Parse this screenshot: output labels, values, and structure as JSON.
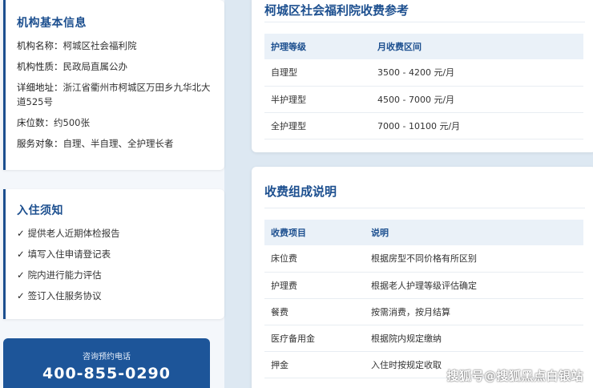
{
  "info_card": {
    "title": "机构基本信息",
    "lines": [
      {
        "label": "机构名称：",
        "value": "柯城区社会福利院"
      },
      {
        "label": "机构性质：",
        "value": "民政局直属公办"
      },
      {
        "label": "详细地址：",
        "value": "浙江省衢州市柯城区万田乡九华北大道525号"
      },
      {
        "label": "床位数：",
        "value": "约500张"
      },
      {
        "label": "服务对象：",
        "value": "自理、半自理、全护理长者"
      }
    ]
  },
  "notes_card": {
    "title": "入住须知",
    "check_mark": "✓",
    "items": [
      "提供老人近期体检报告",
      "填写入住申请登记表",
      "院内进行能力评估",
      "签订入住服务协议"
    ]
  },
  "phone": {
    "label": "咨询预约电话",
    "number": "400-855-0290"
  },
  "fees_card": {
    "title": "柯城区社会福利院收费参考",
    "headers": [
      "护理等级",
      "月收费区间"
    ],
    "rows": [
      [
        "自理型",
        "3500 - 4200 元/月"
      ],
      [
        "半护理型",
        "4500 - 7000 元/月"
      ],
      [
        "全护理型",
        "7000 - 10100 元/月"
      ]
    ]
  },
  "composition_card": {
    "title": "收费组成说明",
    "headers": [
      "收费项目",
      "说明"
    ],
    "rows": [
      [
        "床位费",
        "根据房型不同价格有所区别"
      ],
      [
        "护理费",
        "根据老人护理等级评估确定"
      ],
      [
        "餐费",
        "按需消费，按月结算"
      ],
      [
        "医疗备用金",
        "根据院内规定缴纳"
      ],
      [
        "押金",
        "入住时按规定收取"
      ]
    ]
  },
  "watermark": "搜狐号@搜狐黑点白银站",
  "colors": {
    "accent": "#1c4f8f",
    "phone_bg": "#1d5599",
    "header_bg": "#eaf1f8",
    "page_bg": "#dde8f2"
  }
}
